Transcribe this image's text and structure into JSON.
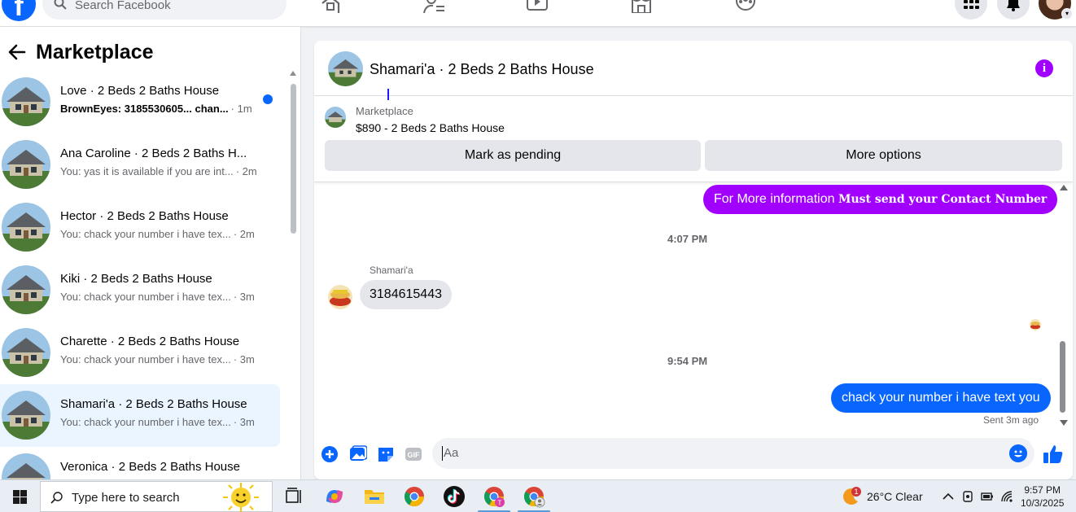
{
  "search": {
    "placeholder": "Search Facebook"
  },
  "sidebar": {
    "title": "Marketplace",
    "conversations": [
      {
        "name": "Love · 2 Beds 2 Baths House",
        "preview": "BrownEyes: 3185530605... chan...",
        "time": "· 1m",
        "unread": true
      },
      {
        "name": "Ana Caroline · 2 Beds 2 Baths H...",
        "preview": "You: yas it is available if you are int...",
        "time": "· 2m"
      },
      {
        "name": "Hector · 2 Beds 2 Baths House",
        "preview": "You: chack your number i have tex...",
        "time": "· 2m"
      },
      {
        "name": "Kiki · 2 Beds 2 Baths House",
        "preview": "You: chack your number i have tex...",
        "time": "· 3m"
      },
      {
        "name": "Charette · 2 Beds 2 Baths House",
        "preview": "You: chack your number i have tex...",
        "time": "· 3m"
      },
      {
        "name": "Shamari'a · 2 Beds 2 Baths House",
        "preview": "You: chack your number i have tex...",
        "time": "· 3m",
        "active": true
      },
      {
        "name": "Veronica · 2 Beds 2 Baths House",
        "preview": "",
        "time": ""
      }
    ]
  },
  "chat": {
    "title": "Shamari'a · 2 Beds 2 Baths House",
    "listing": {
      "label": "Marketplace",
      "title": "$890 - 2 Beds 2 Baths House",
      "mark_pending": "Mark as pending",
      "more_options": "More options"
    },
    "messages": {
      "out1_plain": "For More information",
      "out1_bold": "Must send your Contact Number",
      "time1": "4:07 PM",
      "sender": "Shamari'a",
      "in1": "3184615443",
      "time2": "9:54 PM",
      "out2": "chack your number i have text you",
      "status": "Sent 3m ago"
    },
    "composer_placeholder": "Aa"
  },
  "taskbar": {
    "search_placeholder": "Type here to search",
    "weather": "26°C  Clear",
    "weather_badge": "1",
    "time": "9:57 PM",
    "date": "10/3/2025"
  },
  "colors": {
    "facebook_blue": "#0866ff",
    "accent_purple": "#a100ff",
    "active_row": "#ebf5ff"
  }
}
